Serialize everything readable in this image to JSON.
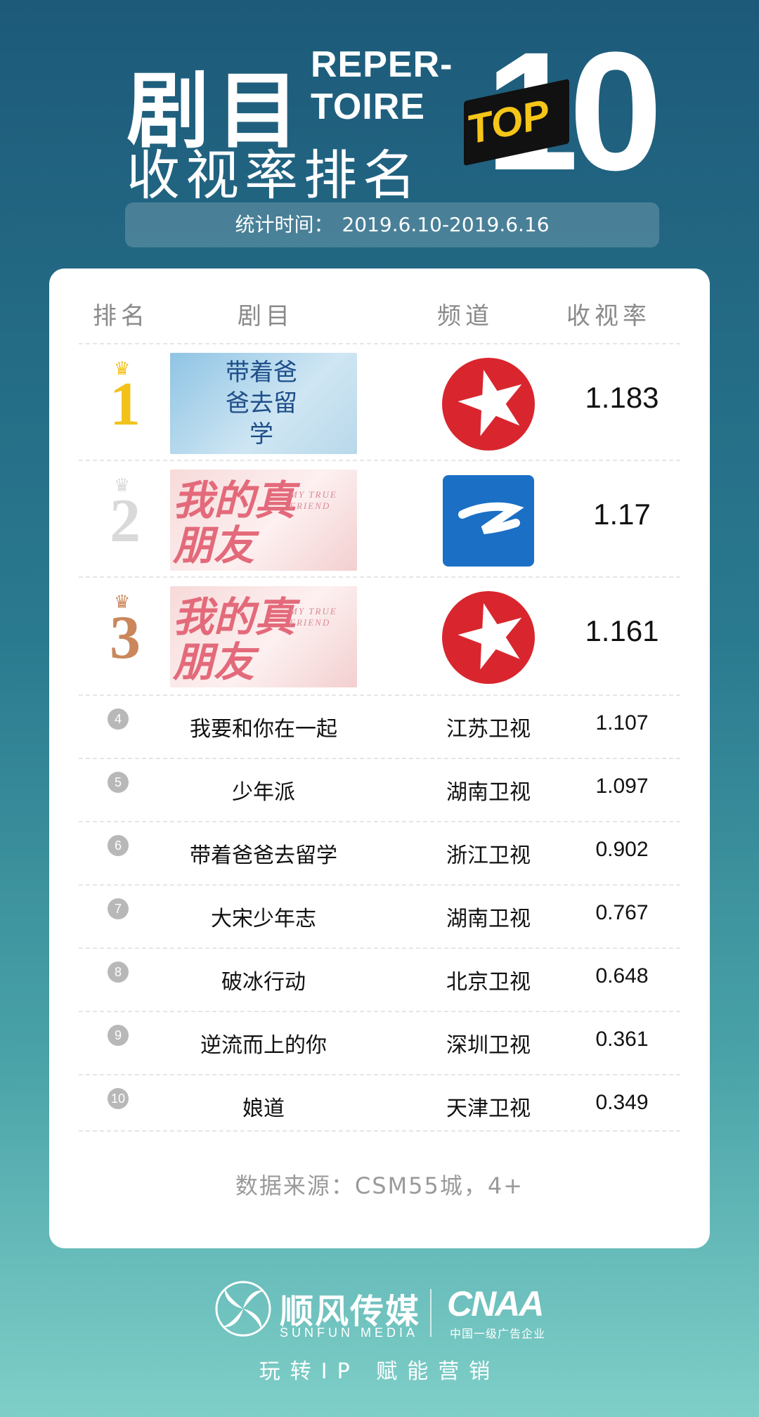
{
  "header": {
    "title_cn": "剧目",
    "title_en_line1": "REPER-",
    "title_en_line2": "TOIRE",
    "subtitle": "收视率排名",
    "badge_top": "TOP",
    "badge_num": "10",
    "period_label": "统计时间：",
    "period_value": "2019.6.10-2019.6.16"
  },
  "table": {
    "columns": [
      "排名",
      "剧目",
      "频道",
      "收视率"
    ],
    "top3": [
      {
        "rank": "1",
        "rank_color": "#f2c21b",
        "poster_title": "带着爸爸去留学",
        "poster_en": "",
        "channel_logo": "dragon-tv-logo-icon",
        "rating": "1.183"
      },
      {
        "rank": "2",
        "rank_color": "#d9d9d9",
        "poster_title": "我的真朋友",
        "poster_en": "MY TRUE FRIEND",
        "channel_logo": "zhejiang-tv-logo-icon",
        "rating": "1.17"
      },
      {
        "rank": "3",
        "rank_color": "#c9875b",
        "poster_title": "我的真朋友",
        "poster_en": "MY TRUE FRIEND",
        "channel_logo": "dragon-tv-logo-icon",
        "rating": "1.161"
      }
    ],
    "rows": [
      {
        "rank": "4",
        "drama": "我要和你在一起",
        "channel": "江苏卫视",
        "rating": "1.107"
      },
      {
        "rank": "5",
        "drama": "少年派",
        "channel": "湖南卫视",
        "rating": "1.097"
      },
      {
        "rank": "6",
        "drama": "带着爸爸去留学",
        "channel": "浙江卫视",
        "rating": "0.902"
      },
      {
        "rank": "7",
        "drama": "大宋少年志",
        "channel": "湖南卫视",
        "rating": "0.767"
      },
      {
        "rank": "8",
        "drama": "破冰行动",
        "channel": "北京卫视",
        "rating": "0.648"
      },
      {
        "rank": "9",
        "drama": "逆流而上的你",
        "channel": "深圳卫视",
        "rating": "0.361"
      },
      {
        "rank": "10",
        "drama": "娘道",
        "channel": "天津卫视",
        "rating": "0.349"
      }
    ],
    "source": "数据来源：CSM55城，4+"
  },
  "footer": {
    "brand_cn": "顺风传媒",
    "brand_en": "SUNFUN MEDIA",
    "partner": "CNAA",
    "partner_sub": "中国一级广告企业",
    "slogan": "玩转IP 赋能营销"
  },
  "colors": {
    "dragon_red": "#d9262e",
    "zhejiang_blue": "#1b6fc4",
    "gold": "#f2c21b",
    "silver": "#d9d9d9",
    "bronze": "#c9875b"
  }
}
